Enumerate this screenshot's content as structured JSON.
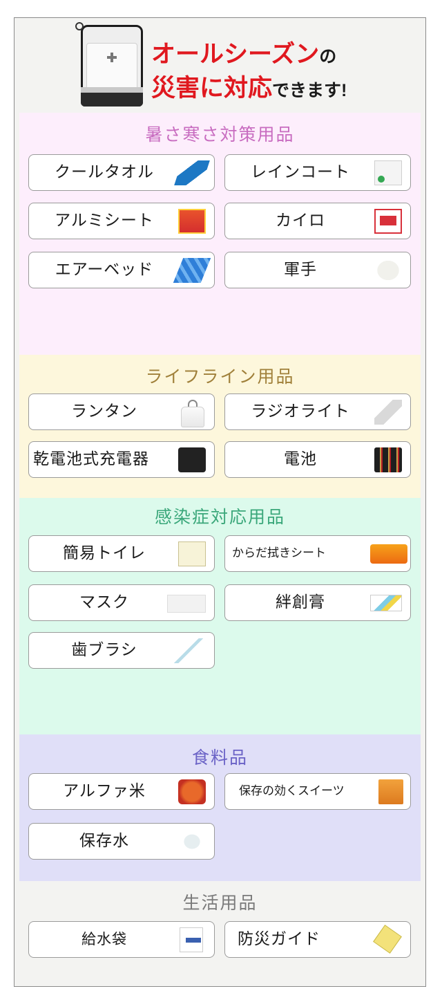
{
  "hero": {
    "line1_main": "オールシーズン",
    "line1_small": "の",
    "line2_main": "災害に対応",
    "line2_small": "できます!"
  },
  "colors": {
    "heat_cold_bg": "#fdeefc",
    "heat_cold_title": "#c86cc0",
    "lifeline_bg": "#fdf7dc",
    "lifeline_title": "#a0803a",
    "infection_bg": "#dcfaec",
    "infection_title": "#3aa77a",
    "food_bg": "#e0dff8",
    "food_title": "#6a62c6",
    "living_bg": "#f3f3f1",
    "living_title": "#7a7a7a"
  },
  "sections": [
    {
      "title": "暑さ寒さ対策用品",
      "items": [
        {
          "label": "クールタオル",
          "icon": "cool-towel-icon"
        },
        {
          "label": "レインコート",
          "icon": "raincoat-icon"
        },
        {
          "label": "アルミシート",
          "icon": "aluminum-sheet-icon"
        },
        {
          "label": "カイロ",
          "icon": "hand-warmer-icon"
        },
        {
          "label": "エアーベッド",
          "icon": "air-bed-icon"
        },
        {
          "label": "軍手",
          "icon": "work-glove-icon"
        }
      ]
    },
    {
      "title": "ライフライン用品",
      "items": [
        {
          "label": "ランタン",
          "icon": "lantern-icon"
        },
        {
          "label": "ラジオライト",
          "icon": "radio-light-icon"
        },
        {
          "label": "乾電池式充電器",
          "icon": "battery-charger-icon"
        },
        {
          "label": "電池",
          "icon": "battery-icon"
        }
      ]
    },
    {
      "title": "感染症対応用品",
      "items": [
        {
          "label": "簡易トイレ",
          "icon": "portable-toilet-icon"
        },
        {
          "label": "からだ拭きシート",
          "icon": "body-wipes-icon"
        },
        {
          "label": "マスク",
          "icon": "mask-icon"
        },
        {
          "label": "絆創膏",
          "icon": "bandage-icon"
        },
        {
          "label": "歯ブラシ",
          "icon": "toothbrush-icon"
        }
      ]
    },
    {
      "title": "食料品",
      "items": [
        {
          "label": "アルファ米",
          "icon": "alpha-rice-icon"
        },
        {
          "label": "保存の効くスイーツ",
          "icon": "preserved-sweets-icon"
        },
        {
          "label": "保存水",
          "icon": "water-bottle-icon"
        }
      ]
    },
    {
      "title": "生活用品",
      "items": [
        {
          "label": "給水袋",
          "icon": "water-bag-icon"
        },
        {
          "label": "防災ガイド",
          "icon": "disaster-guide-icon"
        }
      ]
    }
  ]
}
